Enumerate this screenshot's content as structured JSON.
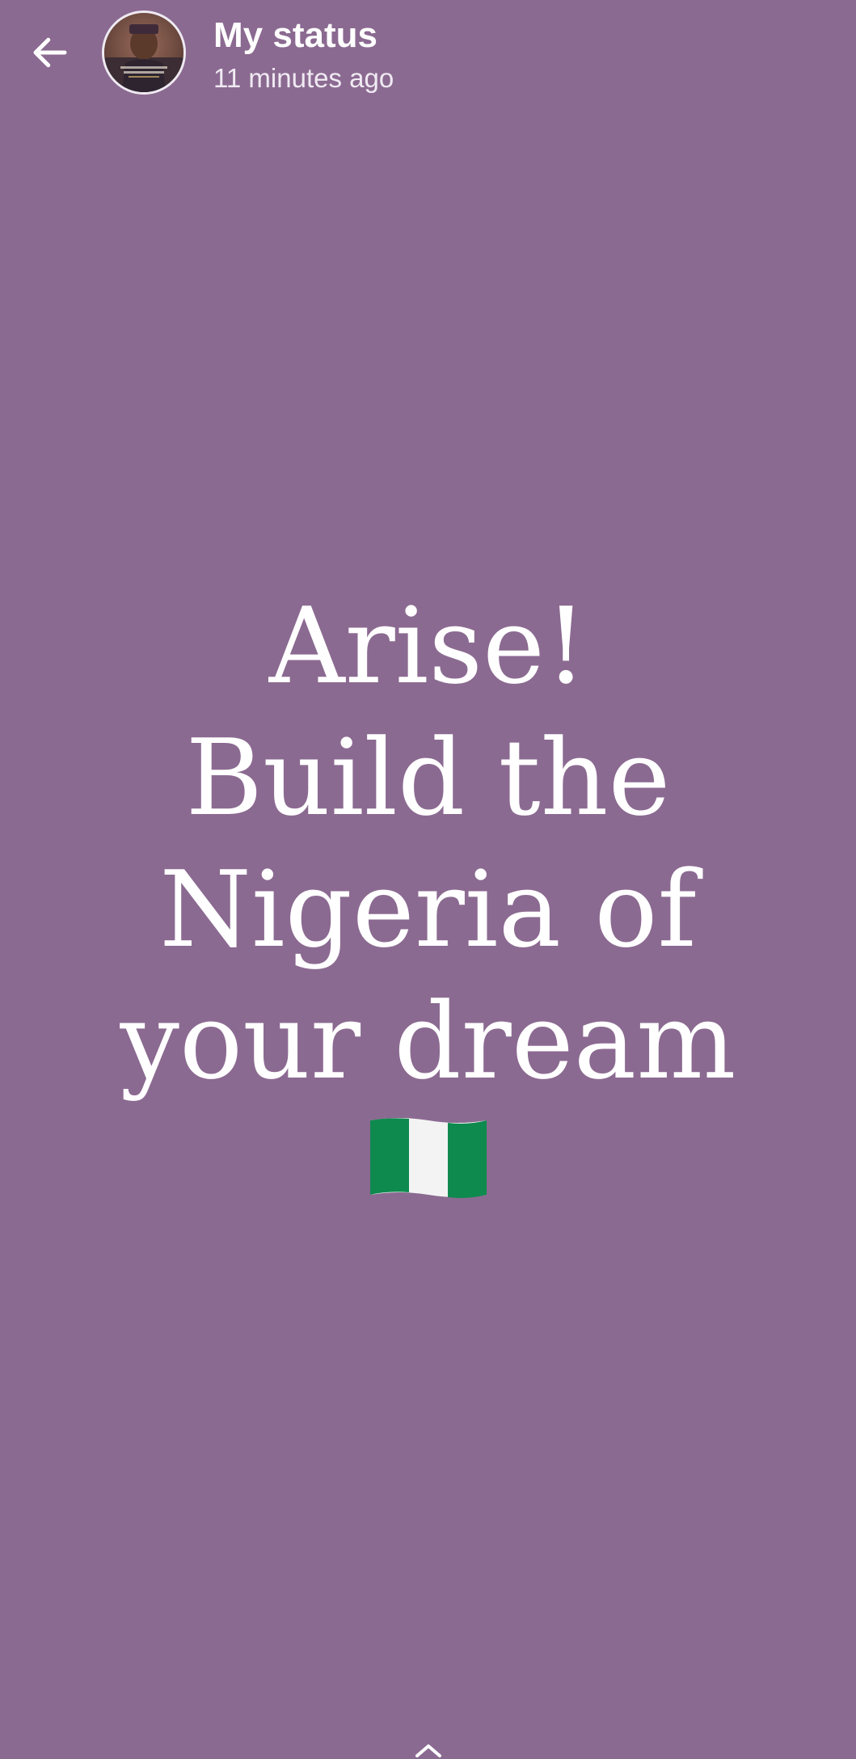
{
  "theme": {
    "background": "#8b6a91",
    "text": "#ffffff"
  },
  "header": {
    "back_icon": "arrow-left-icon",
    "title": "My status",
    "timestamp": "11 minutes ago"
  },
  "status": {
    "lines": [
      "Arise!",
      "Build the",
      "Nigeria of",
      "your dream"
    ],
    "emoji": "nigeria-flag",
    "flag_colors": [
      "#0e8a4f",
      "#f3f3f3",
      "#0e8a4f"
    ]
  }
}
